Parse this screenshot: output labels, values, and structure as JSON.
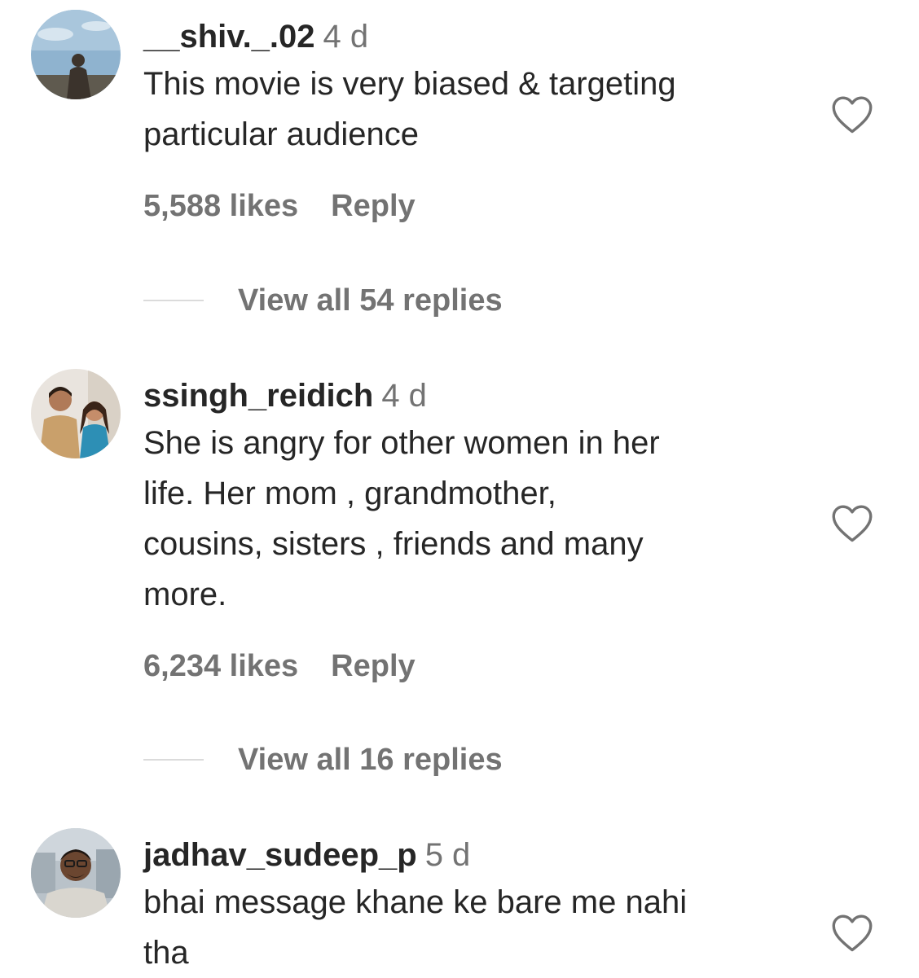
{
  "comments": [
    {
      "username": "__shiv._.02",
      "time": "4 d",
      "lines": [
        "This movie is very biased & targeting",
        "particular audience"
      ],
      "likes": "5,588 likes",
      "reply": "Reply",
      "view_replies": "View all 54 replies"
    },
    {
      "username": "ssingh_reidich",
      "time": "4 d",
      "lines": [
        "She is angry for other women in her",
        "life. Her mom , grandmother,",
        "cousins, sisters , friends and many",
        "more."
      ],
      "likes": "6,234 likes",
      "reply": "Reply",
      "view_replies": "View all 16 replies"
    },
    {
      "username": "jadhav_sudeep_p",
      "time": "5 d",
      "lines": [
        "bhai message khane ke bare me nahi",
        "tha"
      ]
    }
  ],
  "colors": {
    "primary_text": "#262626",
    "secondary_text": "#737373",
    "divider": "#dbdbdb"
  },
  "icons": {
    "like": "heart-outline-icon"
  }
}
